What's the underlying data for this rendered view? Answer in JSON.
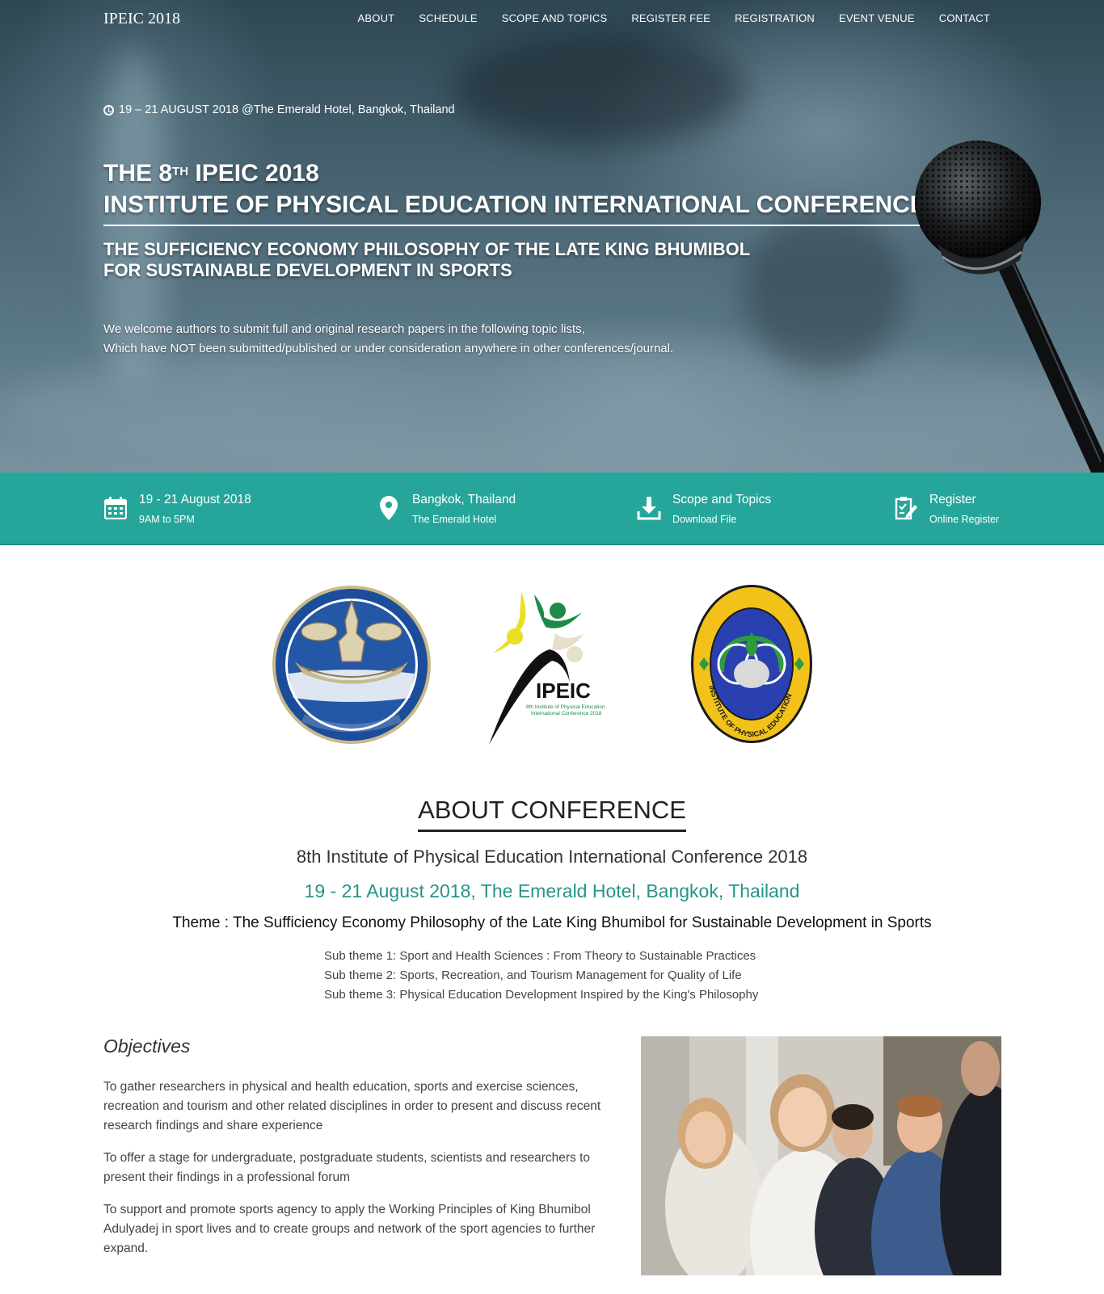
{
  "nav": {
    "brand": "IPEIC 2018",
    "links": [
      "ABOUT",
      "SCHEDULE",
      "SCOPE AND TOPICS",
      "REGISTER FEE",
      "REGISTRATION",
      "EVENT VENUE",
      "CONTACT"
    ]
  },
  "hero": {
    "date_line": "19 – 21 AUGUST 2018 @The Emerald Hotel, Bangkok, Thailand",
    "title_prefix": "THE 8",
    "title_sup": "TH",
    "title_suffix": " IPEIC 2018",
    "title_line2": "INSTITUTE OF PHYSICAL EDUCATION INTERNATIONAL CONFERENCE",
    "subtitle_line1": "THE SUFFICIENCY ECONOMY PHILOSOPHY OF THE LATE KING BHUMIBOL",
    "subtitle_line2": "FOR SUSTAINABLE DEVELOPMENT IN SPORTS",
    "desc_line1": "We welcome authors to submit full and original research papers in the following topic lists,",
    "desc_line2": "Which have NOT been submitted/published or under consideration anywhere in other conferences/journal."
  },
  "infobar": {
    "color": "#26a69a",
    "items": [
      {
        "icon": "calendar-icon",
        "title": "19 - 21 August 2018",
        "sub": "9AM to 5PM"
      },
      {
        "icon": "map-pin-icon",
        "title": "Bangkok, Thailand",
        "sub": "The Emerald Hotel"
      },
      {
        "icon": "download-icon",
        "title": "Scope and Topics",
        "sub": "Download File"
      },
      {
        "icon": "register-icon",
        "title": "Register",
        "sub": "Online Register"
      }
    ]
  },
  "logos": {
    "ipeic_text": "IPEIC",
    "ipeic_small_1": "8th Institute of Physical Education",
    "ipeic_small_2": "International Conference 2018",
    "ipe_ring_text": "INSTITUTE OF PHYSICAL EDUCATION"
  },
  "about": {
    "heading": "ABOUT CONFERENCE",
    "name": "8th Institute of Physical Education International Conference 2018",
    "date_venue": "19 - 21 August 2018, The Emerald Hotel, Bangkok, Thailand",
    "theme": "Theme : The Sufficiency Economy Philosophy of the Late King Bhumibol for Sustainable Development in Sports",
    "subthemes": [
      "Sub theme 1: Sport and Health Sciences : From Theory to Sustainable Practices",
      "Sub theme 2: Sports, Recreation, and Tourism Management for Quality of Life",
      "Sub theme 3: Physical Education Development Inspired by the King's Philosophy"
    ],
    "accent_color": "#26948a"
  },
  "objectives": {
    "title": "Objectives",
    "paragraphs": [
      "To gather researchers in physical and health education, sports and exercise sciences, recreation and tourism and other related disciplines in order to present and discuss recent research findings and share experience",
      "To offer a stage for undergraduate, postgraduate students, scientists and researchers to present their findings in a professional forum",
      "To support and promote sports agency to apply the Working Principles of King Bhumibol Adulyadej in sport lives and to create groups and network of the sport agencies to further expand."
    ]
  }
}
